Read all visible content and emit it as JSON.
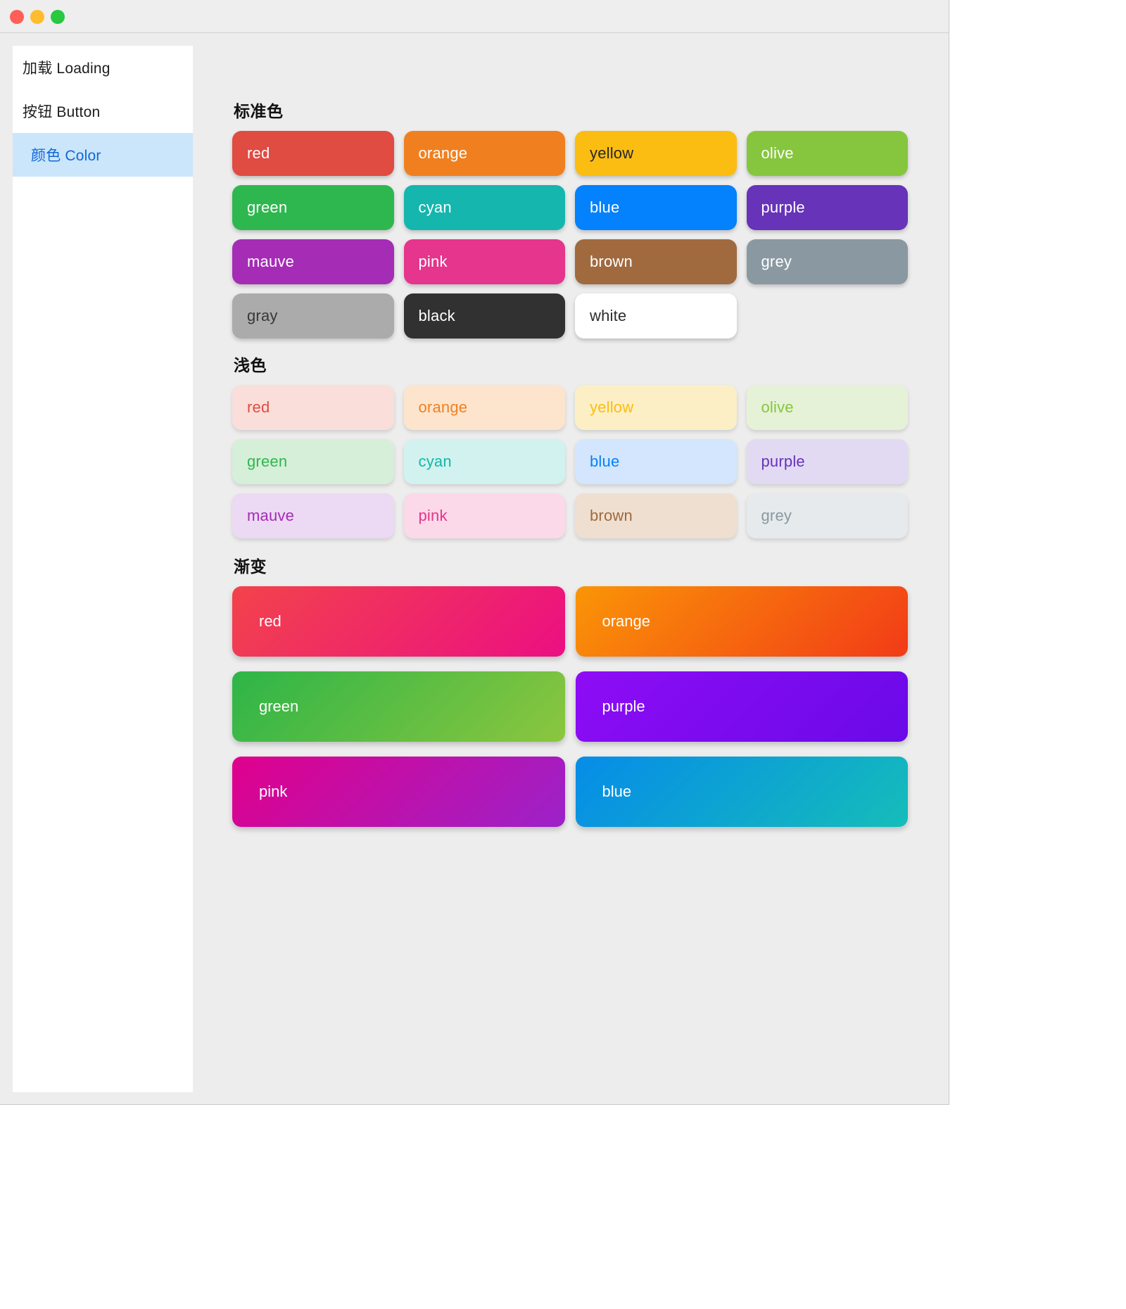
{
  "window": {
    "traffic_lights": [
      {
        "name": "close",
        "color": "#ff5f57"
      },
      {
        "name": "minimize",
        "color": "#febc2e"
      },
      {
        "name": "maximize",
        "color": "#28c840"
      }
    ]
  },
  "sidebar": {
    "items": [
      {
        "label": "加载 Loading",
        "selected": false
      },
      {
        "label": "按钮 Button",
        "selected": false
      },
      {
        "label": "颜色 Color",
        "selected": true
      }
    ],
    "selected_bg": "#cbe5fb",
    "selected_fg": "#1068d8"
  },
  "sections": {
    "standard": {
      "title": "标准色",
      "swatches": [
        {
          "label": "red",
          "bg": "#e04b42",
          "fg": "#ffffff"
        },
        {
          "label": "orange",
          "bg": "#f0801f",
          "fg": "#ffffff"
        },
        {
          "label": "yellow",
          "bg": "#fbbd11",
          "fg": "#272727"
        },
        {
          "label": "olive",
          "bg": "#86c63e",
          "fg": "#ffffff"
        },
        {
          "label": "green",
          "bg": "#2eb74f",
          "fg": "#ffffff"
        },
        {
          "label": "cyan",
          "bg": "#14b6ad",
          "fg": "#ffffff"
        },
        {
          "label": "blue",
          "bg": "#0481fc",
          "fg": "#ffffff"
        },
        {
          "label": "purple",
          "bg": "#6633b9",
          "fg": "#ffffff"
        },
        {
          "label": "mauve",
          "bg": "#a52cb5",
          "fg": "#ffffff"
        },
        {
          "label": "pink",
          "bg": "#e5358c",
          "fg": "#ffffff"
        },
        {
          "label": "brown",
          "bg": "#a06a3e",
          "fg": "#ffffff"
        },
        {
          "label": "grey",
          "bg": "#8a98a2",
          "fg": "#ffffff"
        },
        {
          "label": "gray",
          "bg": "#ababab",
          "fg": "#383838"
        },
        {
          "label": "black",
          "bg": "#313131",
          "fg": "#ffffff"
        },
        {
          "label": "white",
          "bg": "#ffffff",
          "fg": "#2c2c2c"
        }
      ]
    },
    "light": {
      "title": "浅色",
      "swatches": [
        {
          "label": "red",
          "bg": "#fadeda",
          "fg": "#e24b42"
        },
        {
          "label": "orange",
          "bg": "#fde4cd",
          "fg": "#f0801f"
        },
        {
          "label": "yellow",
          "bg": "#fcefc6",
          "fg": "#fbbd11"
        },
        {
          "label": "olive",
          "bg": "#e5f2d7",
          "fg": "#86c63e"
        },
        {
          "label": "green",
          "bg": "#d5efd8",
          "fg": "#2eb74f"
        },
        {
          "label": "cyan",
          "bg": "#d2f2ef",
          "fg": "#14b6ad"
        },
        {
          "label": "blue",
          "bg": "#d3e6fd",
          "fg": "#0481fc"
        },
        {
          "label": "purple",
          "bg": "#e2daf3",
          "fg": "#6633b9"
        },
        {
          "label": "mauve",
          "bg": "#ecd9f3",
          "fg": "#a52cb5"
        },
        {
          "label": "pink",
          "bg": "#fbd9e9",
          "fg": "#e5358c"
        },
        {
          "label": "brown",
          "bg": "#efdfd0",
          "fg": "#a06a3e"
        },
        {
          "label": "grey",
          "bg": "#e6eaec",
          "fg": "#8a98a2"
        }
      ]
    },
    "gradient": {
      "title": "渐变",
      "swatches": [
        {
          "label": "red",
          "from": "#f2434b",
          "to": "#ec0f82",
          "fg": "#ffffff"
        },
        {
          "label": "orange",
          "from": "#fa9507",
          "to": "#f23b17",
          "fg": "#ffffff"
        },
        {
          "label": "green",
          "from": "#2db548",
          "to": "#8cc63e",
          "fg": "#ffffff"
        },
        {
          "label": "purple",
          "from": "#8e0cf5",
          "to": "#6a0ae8",
          "fg": "#ffffff"
        },
        {
          "label": "pink",
          "from": "#e0008c",
          "to": "#9b22c9",
          "fg": "#ffffff"
        },
        {
          "label": "blue",
          "from": "#068ce8",
          "to": "#15bdb9",
          "fg": "#ffffff"
        }
      ]
    }
  }
}
